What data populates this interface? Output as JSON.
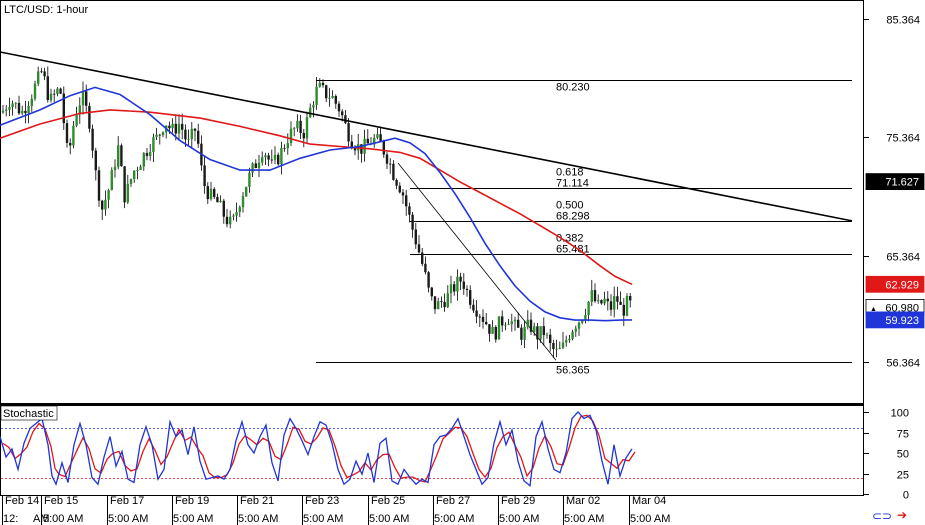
{
  "window": {
    "title": "LTC/USD: 1-hour"
  },
  "colors": {
    "up_candle": "#2e8b2e",
    "down_candle": "#1a1a1a",
    "wick": "#000000",
    "sma_blue": "#1f35d8",
    "sma_red": "#e01818",
    "trendline": "#000000",
    "stoch_k": "#1f35d8",
    "stoch_d": "#e01818",
    "stoch_level": "#1f35d8",
    "price_box": "#000000",
    "red_box": "#e01818",
    "blue_box": "#1f35d8"
  },
  "price_axis": {
    "ticks": [
      "85.364",
      "75.364",
      "65.364",
      "56.364"
    ],
    "tick_values": [
      85.364,
      75.364,
      65.364,
      56.364
    ]
  },
  "price_boxes": [
    {
      "label": "71.627",
      "value": 71.627,
      "color": "#000000"
    },
    {
      "label": "62.929",
      "value": 62.929,
      "color": "#e01818"
    },
    {
      "label": "60.980",
      "value": 60.98,
      "color": "#ffffff",
      "marker": "▲"
    },
    {
      "label": "59.923",
      "value": 59.923,
      "color": "#1f35d8"
    }
  ],
  "fibonacci": {
    "levels": [
      {
        "ratio": "",
        "price": "80.230",
        "value": 80.23
      },
      {
        "ratio": "0.618",
        "price": "71.114",
        "value": 71.114
      },
      {
        "ratio": "0.500",
        "price": "68.298",
        "value": 68.298
      },
      {
        "ratio": "0.382",
        "price": "65.481",
        "value": 65.481
      },
      {
        "ratio": "",
        "price": "56.365",
        "value": 56.365
      }
    ]
  },
  "stochastic": {
    "label": "Stochastic",
    "ticks": [
      "100",
      "75",
      "50",
      "25",
      "0"
    ],
    "tick_values": [
      100,
      75,
      50,
      25,
      0
    ],
    "levels": [
      80,
      20
    ]
  },
  "x_axis": {
    "dates": [
      "Feb 14",
      "Feb 15",
      "Feb 17",
      "Feb 19",
      "Feb 21",
      "Feb 23",
      "Feb 25",
      "Feb 27",
      "Feb 29",
      "Mar 02",
      "Mar 04"
    ],
    "times": [
      "12:",
      "AM",
      "5:00 AM",
      "5:00 AM",
      "5:00 AM",
      "5:00 AM",
      "5:00 AM",
      "5:00 AM",
      "5:00 AM",
      "5:00 AM",
      "5:00 AM",
      "5:00 AM"
    ]
  },
  "chart_data": {
    "type": "candlestick",
    "title": "LTC/USD: 1-hour",
    "ylim": [
      52.8,
      87.0
    ],
    "price_path": [
      [
        0,
        77.2
      ],
      [
        10,
        78.6
      ],
      [
        22,
        77.5
      ],
      [
        32,
        79.1
      ],
      [
        42,
        81.0
      ],
      [
        50,
        78.4
      ],
      [
        60,
        79.6
      ],
      [
        68,
        73.5
      ],
      [
        75,
        77.3
      ],
      [
        82,
        78.9
      ],
      [
        90,
        76.6
      ],
      [
        96,
        72.1
      ],
      [
        102,
        69.3
      ],
      [
        110,
        71.3
      ],
      [
        118,
        74.6
      ],
      [
        125,
        70.2
      ],
      [
        133,
        72.4
      ],
      [
        142,
        73.6
      ],
      [
        150,
        74.8
      ],
      [
        158,
        75.4
      ],
      [
        165,
        76.8
      ],
      [
        172,
        75.9
      ],
      [
        180,
        76.6
      ],
      [
        188,
        74.7
      ],
      [
        196,
        76.2
      ],
      [
        203,
        71.6
      ],
      [
        210,
        70.4
      ],
      [
        218,
        69.8
      ],
      [
        225,
        68.6
      ],
      [
        232,
        67.9
      ],
      [
        240,
        70.1
      ],
      [
        248,
        71.8
      ],
      [
        256,
        73.2
      ],
      [
        263,
        74.5
      ],
      [
        272,
        72.9
      ],
      [
        280,
        73.9
      ],
      [
        288,
        75.4
      ],
      [
        296,
        76.2
      ],
      [
        304,
        75.8
      ],
      [
        312,
        78.3
      ],
      [
        318,
        79.6
      ],
      [
        325,
        79.1
      ],
      [
        332,
        78.8
      ],
      [
        340,
        77.7
      ],
      [
        346,
        76.2
      ],
      [
        352,
        75.1
      ],
      [
        360,
        74.4
      ],
      [
        366,
        74.6
      ],
      [
        373,
        75.2
      ],
      [
        380,
        74.9
      ],
      [
        388,
        73.6
      ],
      [
        394,
        72.2
      ],
      [
        402,
        70.9
      ],
      [
        410,
        68.4
      ],
      [
        418,
        66.0
      ],
      [
        424,
        64.1
      ],
      [
        430,
        61.8
      ],
      [
        436,
        61.0
      ],
      [
        442,
        61.5
      ],
      [
        448,
        61.9
      ],
      [
        455,
        62.8
      ],
      [
        462,
        63.4
      ],
      [
        468,
        62.1
      ],
      [
        474,
        61.2
      ],
      [
        480,
        60.5
      ],
      [
        487,
        59.6
      ],
      [
        494,
        58.6
      ],
      [
        500,
        59.7
      ],
      [
        508,
        60.2
      ],
      [
        515,
        59.3
      ],
      [
        522,
        58.7
      ],
      [
        530,
        59.5
      ],
      [
        537,
        58.6
      ],
      [
        544,
        58.9
      ],
      [
        550,
        57.7
      ],
      [
        556,
        57.1
      ],
      [
        562,
        57.4
      ],
      [
        568,
        58.6
      ],
      [
        574,
        59.5
      ],
      [
        580,
        60.0
      ],
      [
        586,
        61.0
      ],
      [
        592,
        62.0
      ],
      [
        598,
        61.0
      ],
      [
        604,
        61.6
      ],
      [
        610,
        60.8
      ],
      [
        616,
        61.9
      ],
      [
        622,
        60.6
      ],
      [
        628,
        61.4
      ],
      [
        632,
        60.98
      ]
    ],
    "sma_blue": [
      [
        0,
        76.4
      ],
      [
        40,
        77.7
      ],
      [
        70,
        78.9
      ],
      [
        95,
        79.6
      ],
      [
        120,
        79.0
      ],
      [
        150,
        77.3
      ],
      [
        180,
        75.1
      ],
      [
        210,
        73.5
      ],
      [
        240,
        72.6
      ],
      [
        270,
        72.6
      ],
      [
        300,
        73.6
      ],
      [
        330,
        74.3
      ],
      [
        360,
        74.6
      ],
      [
        380,
        75.0
      ],
      [
        395,
        75.3
      ],
      [
        410,
        74.9
      ],
      [
        425,
        74.0
      ],
      [
        440,
        72.4
      ],
      [
        455,
        70.6
      ],
      [
        470,
        68.6
      ],
      [
        485,
        66.4
      ],
      [
        500,
        64.5
      ],
      [
        515,
        62.8
      ],
      [
        530,
        61.5
      ],
      [
        545,
        60.6
      ],
      [
        560,
        60.1
      ],
      [
        575,
        59.9
      ],
      [
        590,
        59.9
      ],
      [
        605,
        59.85
      ],
      [
        620,
        59.9
      ],
      [
        632,
        59.923
      ]
    ],
    "sma_red": [
      [
        0,
        75.3
      ],
      [
        40,
        76.5
      ],
      [
        80,
        77.4
      ],
      [
        110,
        77.7
      ],
      [
        150,
        77.5
      ],
      [
        200,
        77.0
      ],
      [
        240,
        76.3
      ],
      [
        280,
        75.5
      ],
      [
        310,
        74.8
      ],
      [
        340,
        74.6
      ],
      [
        370,
        74.4
      ],
      [
        400,
        74.1
      ],
      [
        420,
        73.6
      ],
      [
        440,
        72.6
      ],
      [
        460,
        71.6
      ],
      [
        480,
        70.7
      ],
      [
        500,
        69.8
      ],
      [
        520,
        68.9
      ],
      [
        540,
        67.9
      ],
      [
        560,
        66.9
      ],
      [
        580,
        65.8
      ],
      [
        600,
        64.5
      ],
      [
        615,
        63.6
      ],
      [
        632,
        62.929
      ]
    ],
    "trendline": {
      "from": [
        0,
        82.6
      ],
      "to": [
        852,
        68.3
      ]
    },
    "stoch_k": [
      [
        0,
        70
      ],
      [
        6,
        45
      ],
      [
        12,
        55
      ],
      [
        18,
        30
      ],
      [
        24,
        62
      ],
      [
        30,
        80
      ],
      [
        36,
        86
      ],
      [
        42,
        92
      ],
      [
        48,
        60
      ],
      [
        52,
        22
      ],
      [
        56,
        12
      ],
      [
        62,
        38
      ],
      [
        68,
        14
      ],
      [
        74,
        60
      ],
      [
        80,
        86
      ],
      [
        86,
        60
      ],
      [
        92,
        20
      ],
      [
        98,
        12
      ],
      [
        104,
        45
      ],
      [
        110,
        70
      ],
      [
        116,
        34
      ],
      [
        122,
        52
      ],
      [
        128,
        18
      ],
      [
        134,
        14
      ],
      [
        140,
        60
      ],
      [
        146,
        82
      ],
      [
        152,
        60
      ],
      [
        158,
        18
      ],
      [
        164,
        30
      ],
      [
        170,
        88
      ],
      [
        176,
        70
      ],
      [
        182,
        78
      ],
      [
        188,
        48
      ],
      [
        194,
        82
      ],
      [
        200,
        40
      ],
      [
        206,
        18
      ],
      [
        212,
        20
      ],
      [
        218,
        22
      ],
      [
        224,
        18
      ],
      [
        230,
        30
      ],
      [
        236,
        65
      ],
      [
        242,
        88
      ],
      [
        248,
        60
      ],
      [
        254,
        50
      ],
      [
        260,
        70
      ],
      [
        266,
        84
      ],
      [
        272,
        38
      ],
      [
        278,
        16
      ],
      [
        284,
        72
      ],
      [
        290,
        92
      ],
      [
        296,
        80
      ],
      [
        302,
        65
      ],
      [
        308,
        48
      ],
      [
        314,
        70
      ],
      [
        320,
        88
      ],
      [
        326,
        84
      ],
      [
        332,
        62
      ],
      [
        338,
        30
      ],
      [
        344,
        12
      ],
      [
        350,
        18
      ],
      [
        356,
        40
      ],
      [
        362,
        24
      ],
      [
        368,
        50
      ],
      [
        374,
        14
      ],
      [
        380,
        62
      ],
      [
        386,
        68
      ],
      [
        392,
        16
      ],
      [
        398,
        12
      ],
      [
        404,
        30
      ],
      [
        410,
        20
      ],
      [
        416,
        12
      ],
      [
        422,
        18
      ],
      [
        428,
        14
      ],
      [
        434,
        60
      ],
      [
        440,
        70
      ],
      [
        446,
        72
      ],
      [
        452,
        80
      ],
      [
        458,
        92
      ],
      [
        464,
        70
      ],
      [
        470,
        48
      ],
      [
        476,
        30
      ],
      [
        482,
        12
      ],
      [
        488,
        20
      ],
      [
        494,
        62
      ],
      [
        500,
        88
      ],
      [
        506,
        60
      ],
      [
        512,
        78
      ],
      [
        518,
        40
      ],
      [
        524,
        16
      ],
      [
        530,
        10
      ],
      [
        536,
        70
      ],
      [
        542,
        88
      ],
      [
        548,
        55
      ],
      [
        554,
        30
      ],
      [
        560,
        26
      ],
      [
        566,
        50
      ],
      [
        572,
        92
      ],
      [
        578,
        100
      ],
      [
        584,
        92
      ],
      [
        590,
        96
      ],
      [
        596,
        78
      ],
      [
        602,
        40
      ],
      [
        608,
        12
      ],
      [
        614,
        60
      ],
      [
        620,
        22
      ],
      [
        626,
        44
      ],
      [
        632,
        55
      ]
    ],
    "stoch_d_offset": 3
  }
}
